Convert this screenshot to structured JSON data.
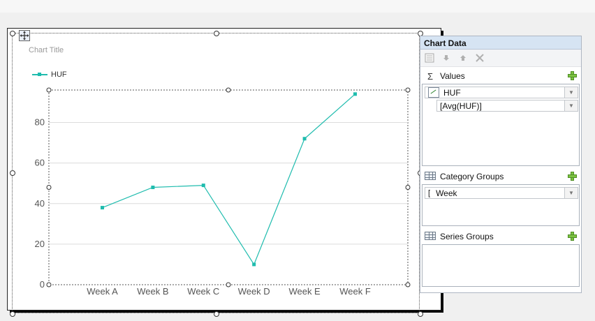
{
  "chart_data": {
    "type": "line",
    "title": "Chart Title",
    "categories": [
      "Week A",
      "Week B",
      "Week C",
      "Week D",
      "Week E",
      "Week F"
    ],
    "series": [
      {
        "name": "HUF",
        "values": [
          38,
          48,
          49,
          10,
          72,
          94
        ]
      }
    ],
    "ylim": [
      0,
      96
    ],
    "yticks": [
      "0",
      "20",
      "40",
      "60",
      "80"
    ],
    "ytick_values": [
      0,
      20,
      40,
      60,
      80
    ],
    "grid": true,
    "legend": "top-left",
    "line_color": "#1fbcae"
  },
  "panel": {
    "title": "Chart Data",
    "values": {
      "label": "Values",
      "series_name": "HUF",
      "expression": "[Avg(HUF)]"
    },
    "category_groups": {
      "label": "Category Groups",
      "item": "Week"
    },
    "series_groups": {
      "label": "Series Groups"
    }
  },
  "icons": {
    "sigma": "Σ",
    "move": "move-icon",
    "properties": "properties-icon",
    "down": "arrow-down-icon",
    "up": "arrow-up-icon",
    "delete": "delete-icon"
  }
}
